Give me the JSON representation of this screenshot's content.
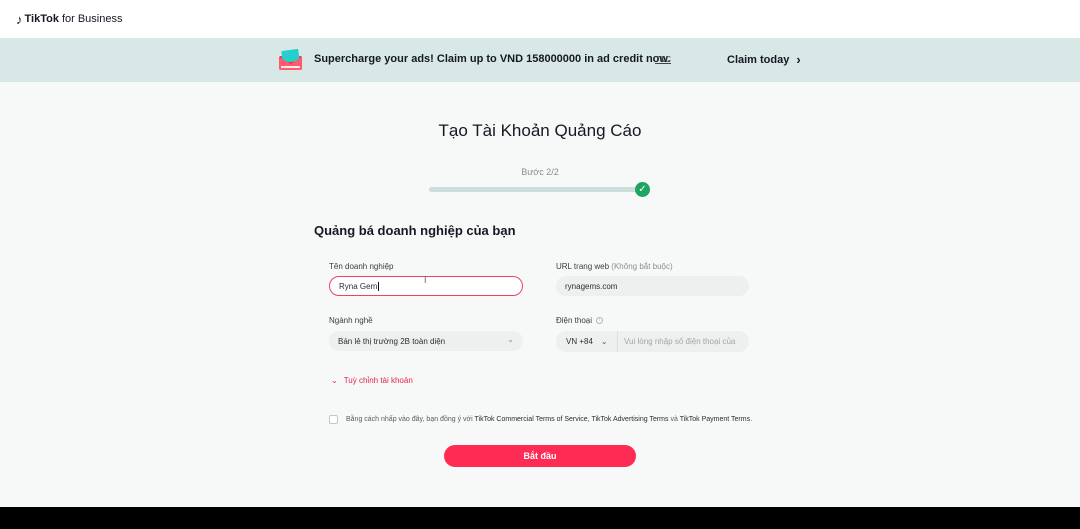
{
  "header": {
    "logo_brand": "TikTok",
    "logo_sub": "for Business"
  },
  "promo": {
    "text": "Supercharge your ads! Claim up to VND 158000000 in ad credit now.",
    "tc_label": "T&C",
    "claim_label": "Claim today"
  },
  "page": {
    "title": "Tạo Tài Khoản Quảng Cáo",
    "step": "Bước 2/2",
    "progress": 1.0,
    "section_title": "Quảng bá doanh nghiệp của bạn"
  },
  "form": {
    "business_name_label": "Tên doanh nghiệp",
    "business_name_value": "Ryna Gem",
    "url_label": "URL trang web",
    "url_optional": "(Không bắt buộc)",
    "url_value": "rynagems.com",
    "industry_label": "Ngành nghề",
    "industry_value": "Bán lẻ thị trường 2B toàn diện",
    "phone_label": "Điện thoại",
    "phone_country": "VN +84",
    "phone_placeholder": "Vui lòng nhập số điện thoại của",
    "customize_label": "Tuỳ chỉnh tài khoản",
    "terms_prefix": "Bằng cách nhấp vào đây, bạn đồng ý với",
    "terms_service": "TikTok Commercial Terms of Service,",
    "terms_advertising": "TikTok Advertising Terms",
    "terms_and": "và",
    "terms_payment": "TikTok Payment Terms.",
    "start_button": "Bắt đầu"
  },
  "colors": {
    "accent": "#fe2c55",
    "success": "#20a464",
    "promo_bg": "#d7e8e7"
  }
}
